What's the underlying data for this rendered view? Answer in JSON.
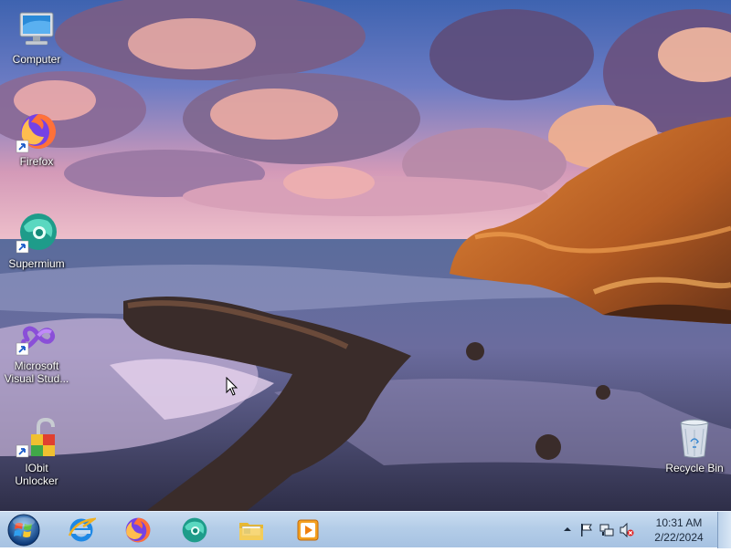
{
  "desktop": {
    "icons": [
      {
        "label": "Computer",
        "icon": "computer-icon"
      },
      {
        "label": "Firefox",
        "icon": "firefox-icon"
      },
      {
        "label": "Supermium",
        "icon": "supermium-icon"
      },
      {
        "label": "Microsoft Visual Stud...",
        "label_line1": "Microsoft",
        "label_line2": "Visual Stud...",
        "icon": "visual-studio-icon"
      },
      {
        "label": "IObit Unlocker",
        "icon": "iobit-unlocker-icon"
      },
      {
        "label": "Recycle Bin",
        "icon": "recycle-bin-icon"
      }
    ]
  },
  "taskbar": {
    "pinned": [
      {
        "name": "Internet Explorer",
        "icon": "internet-explorer-icon"
      },
      {
        "name": "Firefox",
        "icon": "firefox-icon"
      },
      {
        "name": "Supermium",
        "icon": "supermium-icon"
      },
      {
        "name": "File Explorer",
        "icon": "folder-icon"
      },
      {
        "name": "Media Player",
        "icon": "media-player-icon"
      }
    ],
    "tray": {
      "icons": [
        "chevron-up-icon",
        "flag-icon",
        "network-icon",
        "volume-muted-icon"
      ],
      "time": "10:31 AM",
      "date": "2/22/2024"
    }
  },
  "colors": {
    "taskbar": "#b4cde8",
    "sky_top": "#4a6fb8",
    "sunset_pink": "#e8a0b4",
    "cliff_orange": "#d9782c",
    "sea": "#4a5680"
  }
}
